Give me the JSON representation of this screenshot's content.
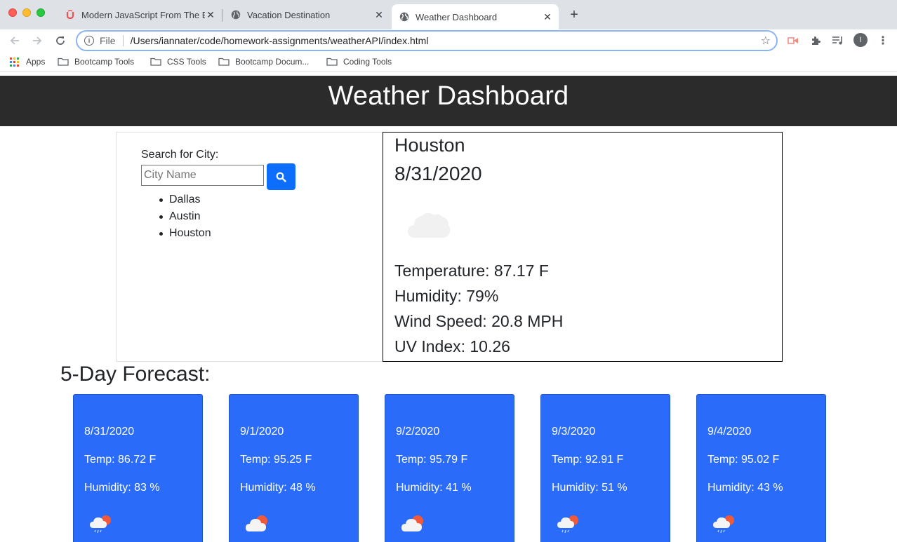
{
  "browser": {
    "tabs": [
      {
        "title": "Modern JavaScript From The B",
        "icon": "udemy-icon"
      },
      {
        "title": "Vacation Destination",
        "icon": "globe-icon"
      },
      {
        "title": "Weather Dashboard",
        "icon": "globe-icon",
        "active": true
      }
    ],
    "address": {
      "scheme": "File",
      "url": "/Users/iannater/code/homework-assignments/weatherAPI/index.html"
    },
    "profile_initial": "I",
    "bookmarks": [
      {
        "label": "Apps",
        "icon": "apps-grid-icon"
      },
      {
        "label": "Bootcamp Tools",
        "icon": "folder-icon"
      },
      {
        "label": "CSS Tools",
        "icon": "folder-icon"
      },
      {
        "label": "Bootcamp Docum...",
        "icon": "folder-icon"
      },
      {
        "label": "Coding Tools",
        "icon": "folder-icon"
      }
    ]
  },
  "header": {
    "title": "Weather Dashboard"
  },
  "search": {
    "label": "Search for City:",
    "placeholder": "City Name",
    "history": [
      "Dallas",
      "Austin",
      "Houston"
    ]
  },
  "current": {
    "city": "Houston",
    "date": "8/31/2020",
    "icon": "cloud-icon",
    "temperature": "Temperature: 87.17 F",
    "humidity": "Humidity: 79%",
    "wind": "Wind Speed: 20.8 MPH",
    "uv": "UV Index: 10.26"
  },
  "forecast": {
    "title": "5-Day Forecast:",
    "days": [
      {
        "date": "8/31/2020",
        "temp": "Temp: 86.72 F",
        "humidity": "Humidity: 83 %",
        "icon": "sun-rain-cloud-icon"
      },
      {
        "date": "9/1/2020",
        "temp": "Temp: 95.25 F",
        "humidity": "Humidity: 48 %",
        "icon": "sun-cloud-icon"
      },
      {
        "date": "9/2/2020",
        "temp": "Temp: 95.79 F",
        "humidity": "Humidity: 41 %",
        "icon": "sun-cloud-icon"
      },
      {
        "date": "9/3/2020",
        "temp": "Temp: 92.91 F",
        "humidity": "Humidity: 51 %",
        "icon": "sun-rain-cloud-icon"
      },
      {
        "date": "9/4/2020",
        "temp": "Temp: 95.02 F",
        "humidity": "Humidity: 43 %",
        "icon": "sun-rain-cloud-icon"
      }
    ]
  },
  "colors": {
    "header_bg": "#2b2b2b",
    "card_bg": "#2a6bf9",
    "button_bg": "#0d6efd"
  }
}
